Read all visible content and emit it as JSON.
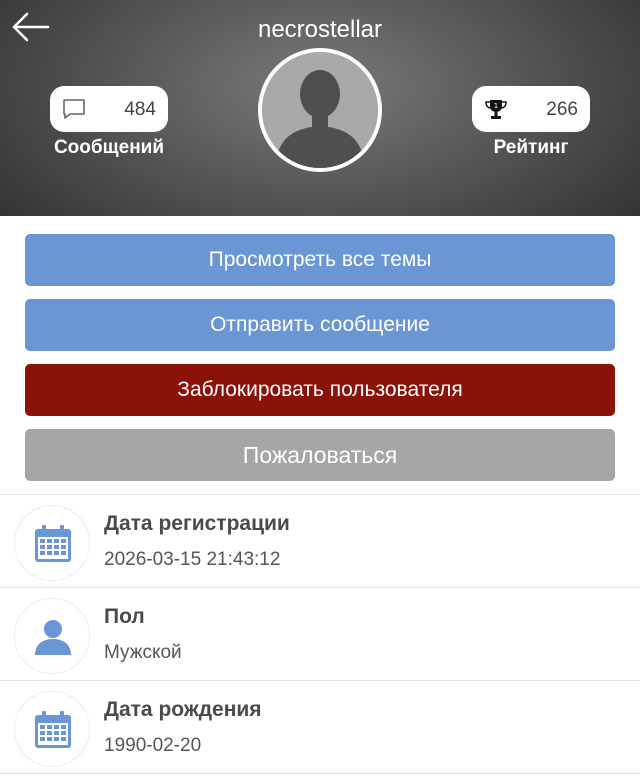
{
  "header": {
    "username": "necrostellar",
    "messages": {
      "count": "484",
      "label": "Сообщений"
    },
    "rating": {
      "count": "266",
      "label": "Рейтинг"
    }
  },
  "actions": {
    "view_topics": "Просмотреть все темы",
    "send_message": "Отправить сообщение",
    "block_user": "Заблокировать пользователя",
    "report": "Пожаловаться"
  },
  "info": [
    {
      "title": "Дата регистрации",
      "value": "2026-03-15 21:43:12",
      "icon": "calendar-icon"
    },
    {
      "title": "Пол",
      "value": "Мужской",
      "icon": "person-icon"
    },
    {
      "title": "Дата рождения",
      "value": "1990-02-20",
      "icon": "calendar-icon"
    }
  ],
  "colors": {
    "primary_button": "#6a96d3",
    "danger_button": "#8b1208",
    "disabled_button": "#a6a6a6",
    "icon_blue": "#6a96d3"
  }
}
